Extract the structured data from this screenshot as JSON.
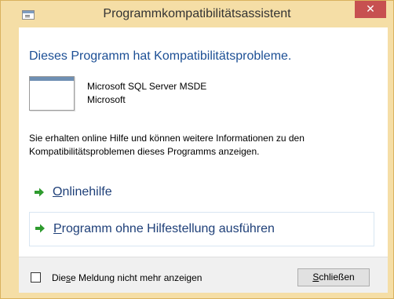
{
  "window": {
    "title": "Programmkompatibilitätsassistent",
    "close_glyph": "✕"
  },
  "main": {
    "heading": "Dieses Programm hat Kompatibilitätsprobleme.",
    "program_name": "Microsoft SQL Server MSDE",
    "program_publisher": "Microsoft",
    "info_text": "Sie erhalten online Hilfe und können weitere Informationen zu den Kompatibilitätsproblemen dieses Programms anzeigen."
  },
  "options": {
    "online_first": "O",
    "online_rest": "nlinehilfe",
    "run_first": "P",
    "run_rest": "rogramm ohne Hilfestellung ausführen"
  },
  "footer": {
    "checkbox_pre": "Die",
    "checkbox_accel": "s",
    "checkbox_post": "e Meldung nicht mehr anzeigen",
    "checkbox_checked": false,
    "close_accel": "S",
    "close_rest": "chließen"
  },
  "colors": {
    "title_bar": "#f5dea6",
    "heading": "#1c4f95",
    "link": "#1e3f78",
    "arrow": "#2e9b2e",
    "close_button": "#c75050"
  },
  "icons": {
    "window": "application-window-icon",
    "program": "program-window-icon",
    "option": "green-arrow-icon",
    "close": "close-icon"
  }
}
